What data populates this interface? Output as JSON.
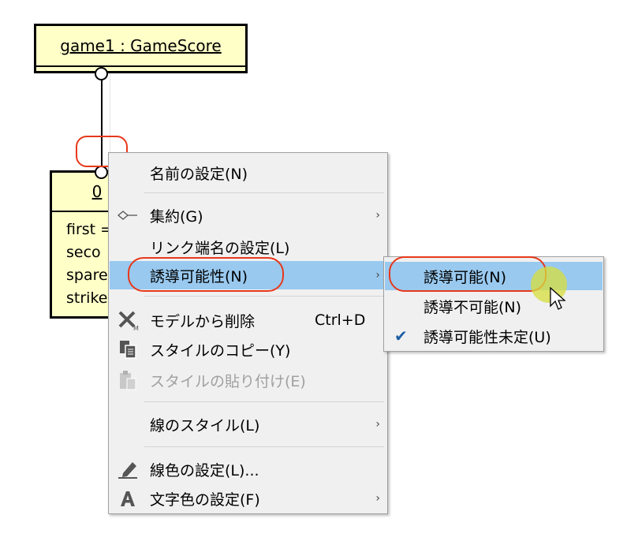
{
  "diagram": {
    "object1_title": "game1 : GameScore",
    "object2_title": "0",
    "object2_attrs": [
      "first =",
      "seco",
      "spare",
      "strike"
    ]
  },
  "context_menu": {
    "items": [
      {
        "label": "名前の設定(N)"
      },
      {
        "label": "集約(G)",
        "icon": "aggregation-diamond-icon",
        "submenu": true
      },
      {
        "label": "リンク端名の設定(L)"
      },
      {
        "label": "誘導可能性(N)",
        "submenu": true,
        "selected": true
      },
      {
        "label": "モデルから削除",
        "icon": "delete-x-icon",
        "shortcut": "Ctrl+D"
      },
      {
        "label": "スタイルのコピー(Y)",
        "icon": "copy-style-icon"
      },
      {
        "label": "スタイルの貼り付け(E)",
        "icon": "paste-style-icon",
        "disabled": true
      },
      {
        "label": "線のスタイル(L)",
        "submenu": true
      },
      {
        "label": "線色の設定(L)...",
        "icon": "pen-icon"
      },
      {
        "label": "文字色の設定(F)",
        "icon": "text-color-icon",
        "submenu": true
      }
    ]
  },
  "submenu": {
    "items": [
      {
        "label": "誘導可能(N)",
        "selected": true
      },
      {
        "label": "誘導不可能(N)"
      },
      {
        "label": "誘導可能性未定(U)",
        "checked": true
      }
    ]
  },
  "colors": {
    "selection": "#99c9ef",
    "highlight": "#e8381a",
    "object_fill": "#ffffc8"
  }
}
